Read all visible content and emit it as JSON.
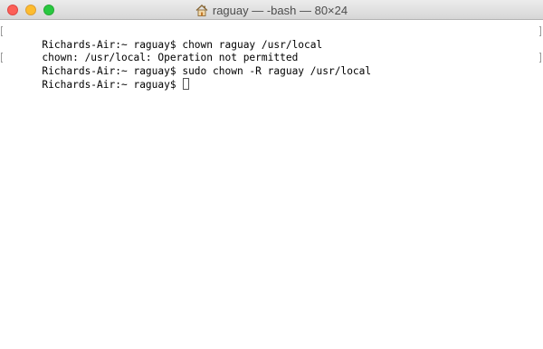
{
  "window": {
    "title": "raguay — -bash — 80×24",
    "title_icon": "home-icon"
  },
  "terminal": {
    "lines": [
      {
        "text": "Richards-Air:~ raguay$ chown raguay /usr/local",
        "marked": true
      },
      {
        "text": "chown: /usr/local: Operation not permitted",
        "marked": false
      },
      {
        "text": "Richards-Air:~ raguay$ sudo chown -R raguay /usr/local",
        "marked": true
      }
    ],
    "prompt": "Richards-Air:~ raguay$ "
  },
  "colors": {
    "close": "#fc5f57",
    "minimize": "#fdbc2e",
    "zoom": "#28c840",
    "text": "#000000",
    "background": "#ffffff"
  }
}
